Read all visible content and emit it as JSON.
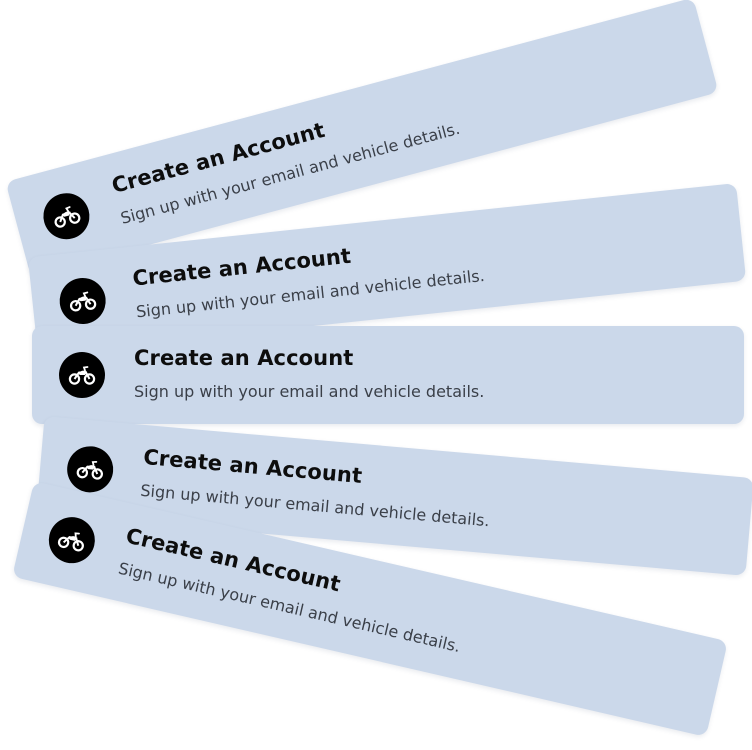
{
  "cards": [
    {
      "title": "Create an Account",
      "subtitle": "Sign up with your email and vehicle details.",
      "icon": "motorcycle-icon"
    },
    {
      "title": "Create an Account",
      "subtitle": "Sign up with your email and vehicle details.",
      "icon": "motorcycle-icon"
    },
    {
      "title": "Create an Account",
      "subtitle": "Sign up with your email and vehicle details.",
      "icon": "motorcycle-icon"
    },
    {
      "title": "Create an Account",
      "subtitle": "Sign up with your email and vehicle details.",
      "icon": "motorcycle-icon"
    },
    {
      "title": "Create an Account",
      "subtitle": "Sign up with your email and vehicle details.",
      "icon": "motorcycle-icon"
    }
  ],
  "colors": {
    "card_background": "#cbd8ea",
    "icon_circle": "#000000",
    "title_text": "#0d0d0d",
    "subtitle_text": "#3a3f48"
  }
}
